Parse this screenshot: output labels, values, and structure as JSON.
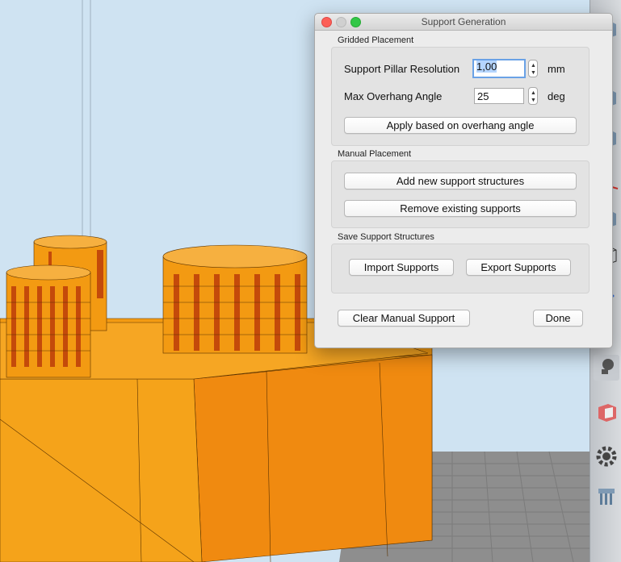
{
  "dialog": {
    "title": "Support Generation",
    "gridded": {
      "title": "Gridded Placement",
      "resolution_label": "Support Pillar Resolution",
      "resolution_value": "1,00",
      "resolution_unit": "mm",
      "angle_label": "Max Overhang Angle",
      "angle_value": "25",
      "angle_unit": "deg",
      "apply_label": "Apply based on overhang angle"
    },
    "manual": {
      "title": "Manual Placement",
      "add_label": "Add new support structures",
      "remove_label": "Remove existing supports"
    },
    "save": {
      "title": "Save Support Structures",
      "import_label": "Import Supports",
      "export_label": "Export Supports"
    },
    "clear_label": "Clear Manual Support",
    "done_label": "Done"
  },
  "colors": {
    "model_orange": "#f39a12",
    "model_dark": "#c44a0a",
    "floor": "#8c8c8c",
    "sky": "#cfe3f2",
    "focus_blue": "#6aa2e6"
  },
  "toolbar": {
    "icons": [
      "cube-icon",
      "cube-icon",
      "cube-icon",
      "axes-icon",
      "cube-icon",
      "wireframe-icon",
      "dots-icon",
      "axes-icon",
      "light-bulb-icon",
      "cut-cube-icon",
      "gear-icon",
      "support-icon"
    ]
  }
}
